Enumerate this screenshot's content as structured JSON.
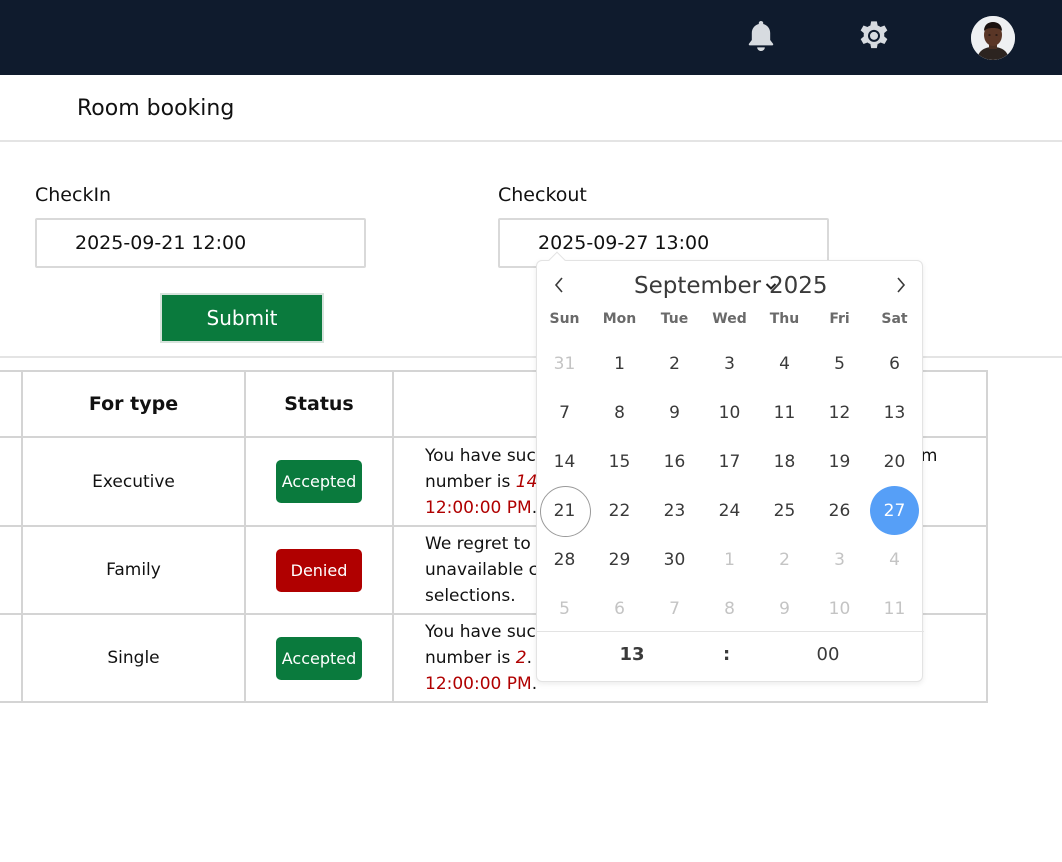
{
  "header": {
    "icons": [
      "bell-icon",
      "gear-icon"
    ],
    "avatar": "user-avatar",
    "colors": {
      "background": "#0f1b2d",
      "icon": "#d7dbe0"
    }
  },
  "page": {
    "title": "Room booking"
  },
  "form": {
    "checkin_label": "CheckIn",
    "checkin_value": "2025-09-21 12:00",
    "checkout_label": "Checkout",
    "checkout_value": "2025-09-27 13:00",
    "submit_label": "Submit",
    "colors": {
      "submit": "#0a7a3d"
    }
  },
  "table": {
    "headers": [
      "",
      "For type",
      "Status",
      ""
    ],
    "rows": [
      {
        "type": "Executive",
        "status": "Accepted",
        "line1": "You have suc",
        "line1_end": "m",
        "line2_pre": "number is ",
        "room": "14",
        "line2_post": ".",
        "line3": "12:00:00 PM",
        "line3_post": "."
      },
      {
        "type": "Family",
        "status": "Denied",
        "line1": "We regret to",
        "line2": "unavailable c",
        "line3": "selections."
      },
      {
        "type": "Single",
        "status": "Accepted",
        "line1": "You have suc",
        "line2_pre": "number is ",
        "room": "2",
        "line2_post": ". Y",
        "line3": "12:00:00 PM",
        "line3_post": "."
      }
    ],
    "colors": {
      "accepted": "#0a7a3d",
      "denied": "#b00000",
      "highlight": "#b00000"
    }
  },
  "datepicker": {
    "month": "September",
    "year": "2025",
    "weekdays": [
      "Sun",
      "Mon",
      "Tue",
      "Wed",
      "Thu",
      "Fri",
      "Sat"
    ],
    "weeks": [
      [
        "31",
        "1",
        "2",
        "3",
        "4",
        "5",
        "6"
      ],
      [
        "7",
        "8",
        "9",
        "10",
        "11",
        "12",
        "13"
      ],
      [
        "14",
        "15",
        "16",
        "17",
        "18",
        "19",
        "20"
      ],
      [
        "21",
        "22",
        "23",
        "24",
        "25",
        "26",
        "27"
      ],
      [
        "28",
        "29",
        "30",
        "1",
        "2",
        "3",
        "4"
      ],
      [
        "5",
        "6",
        "7",
        "8",
        "9",
        "10",
        "11"
      ]
    ],
    "today": "21",
    "selected": "27",
    "time_hour": "13",
    "time_sep": ":",
    "time_minute": "00",
    "colors": {
      "selected": "#569ff7"
    }
  }
}
